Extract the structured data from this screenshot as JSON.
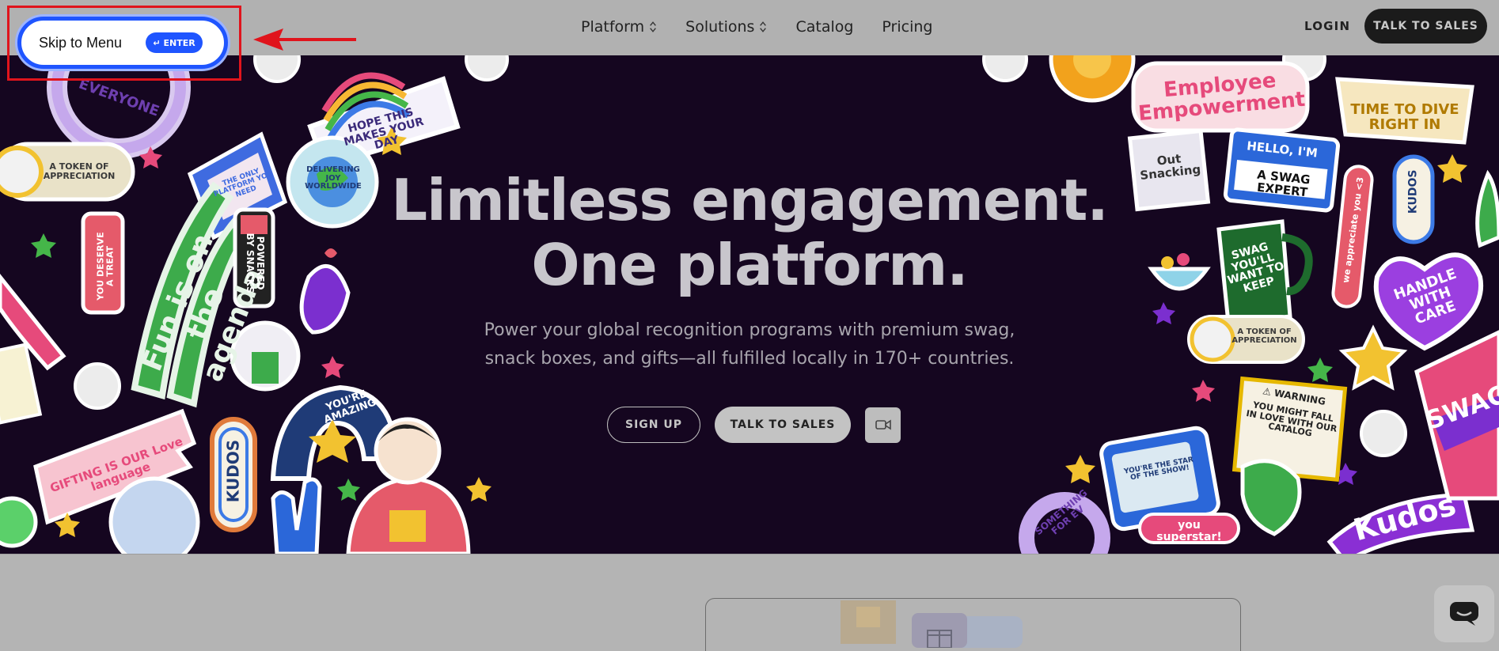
{
  "skip": {
    "label": "Skip to Menu",
    "badge": "↵ ENTER"
  },
  "nav": {
    "items": [
      {
        "label": "Platform",
        "has_dropdown": true
      },
      {
        "label": "Solutions",
        "has_dropdown": true
      },
      {
        "label": "Catalog",
        "has_dropdown": false
      },
      {
        "label": "Pricing",
        "has_dropdown": false
      }
    ],
    "login": "LOGIN",
    "cta": "TALK TO SALES"
  },
  "hero": {
    "title_line1": "Limitless engagement.",
    "title_line2": "One platform.",
    "subtitle_line1": "Power your global recognition programs with premium swag,",
    "subtitle_line2": "snack boxes, and gifts—all fulfilled locally in 170+ countries.",
    "signup": "SIGN UP",
    "talk": "TALK TO SALES"
  },
  "stickers": {
    "hope": "HOPE THIS MAKES YOUR DAY",
    "token": "A TOKEN OF APPRECIATION",
    "fun": "Fun is on the agenda",
    "deserve": "YOU DESERVE A TREAT",
    "snacks": "POWERED BY SNACKS",
    "delivering": "DELIVERING JOY WORLDWIDE",
    "only": "THE ONLY PLATFORM YOU NEED",
    "gifting": "GIFTING IS OUR Love language",
    "kudos": "KUDOS",
    "amazing": "YOU'RE AMAZING",
    "employee": "Employee Empowerment",
    "dive": "TIME TO DIVE RIGHT IN",
    "out": "Out Snacking",
    "swag_expert_top": "HELLO, I'M",
    "swag_expert": "A SWAG EXPERT",
    "keep": "SWAG YOU'LL WANT TO KEEP",
    "appreciate": "we appreciate you <3",
    "handle": "HANDLE WITH CARE",
    "warning_title": "⚠ WARNING",
    "warning": "YOU MIGHT FALL IN LOVE WITH OUR CATALOG",
    "star_show": "YOU'RE THE STAR OF THE SHOW!",
    "superstar": "you superstar!",
    "kudos_script": "Kudos",
    "everyone": "EVERYONE",
    "something": "SOMETHING FOR EV",
    "swag": "SWAG"
  },
  "colors": {
    "accent_blue": "#1f55ff",
    "highlight_red": "#e0141c",
    "hero_bg": "#150620"
  }
}
